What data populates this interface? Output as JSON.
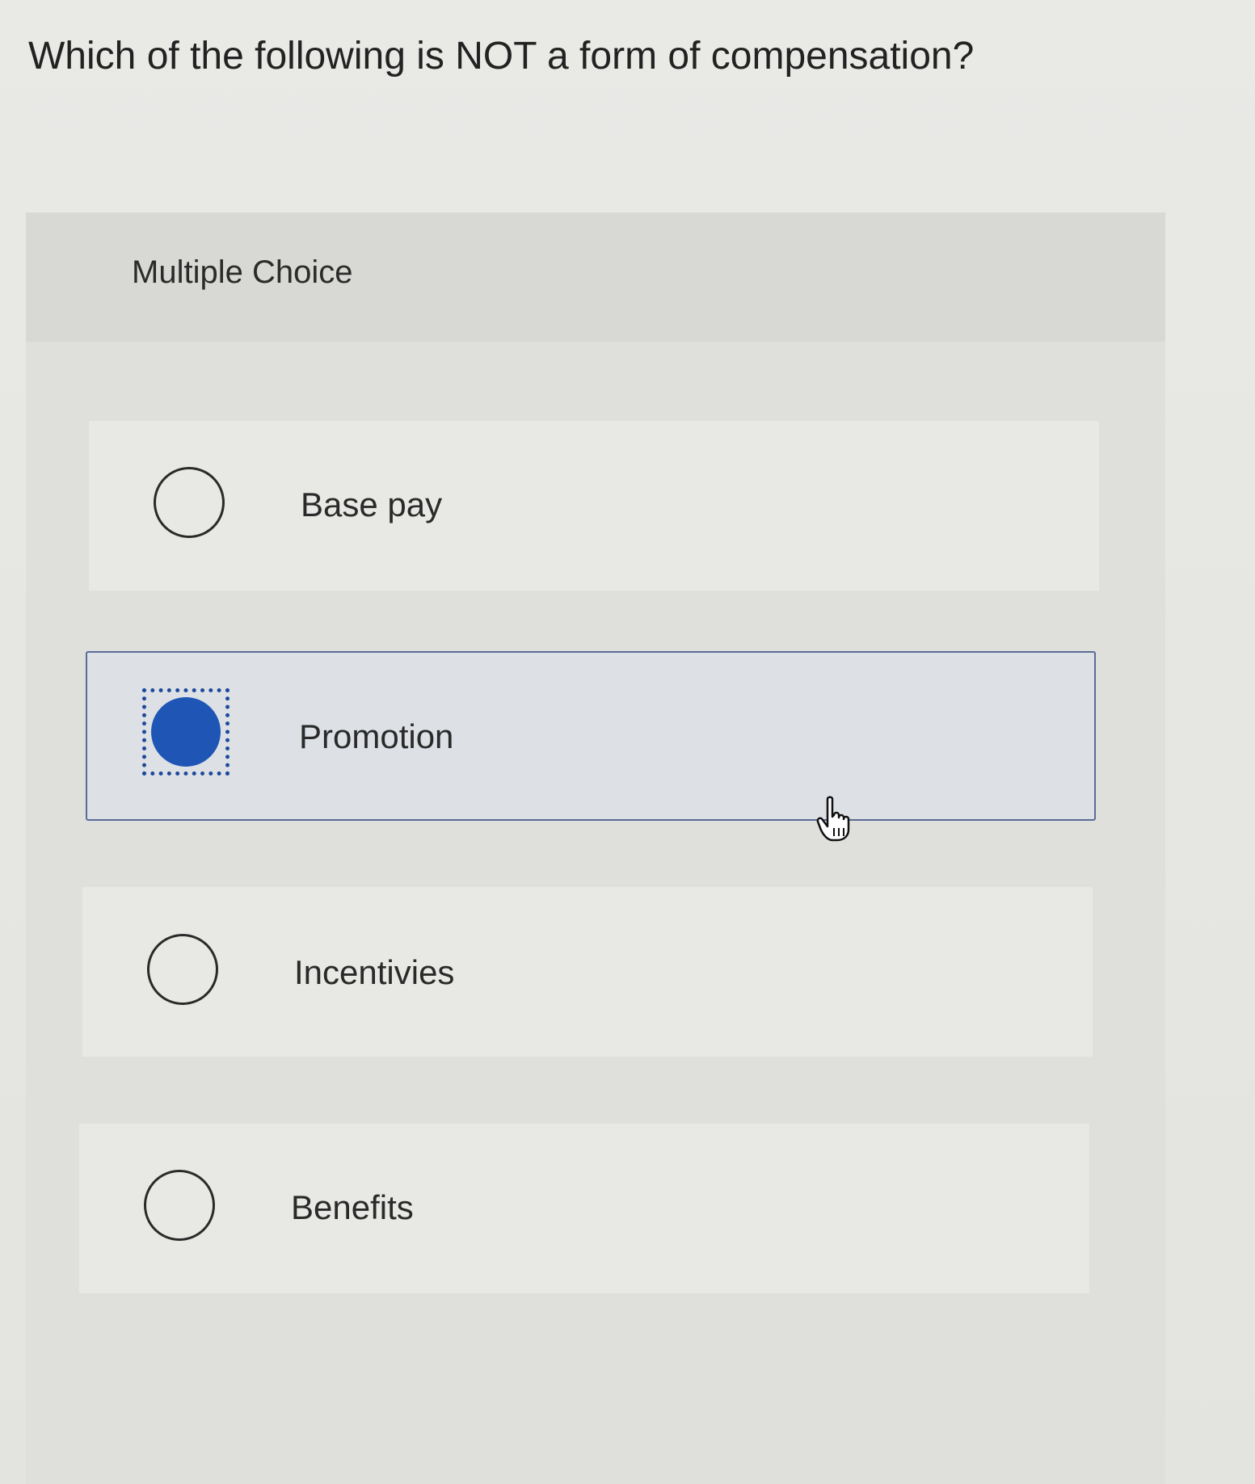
{
  "question": {
    "text": "Which of the following is NOT a form of compensation?"
  },
  "panel": {
    "type_label": "Multiple Choice"
  },
  "options": [
    {
      "label": "Base pay",
      "selected": false
    },
    {
      "label": "Promotion",
      "selected": true
    },
    {
      "label": "Incentivies",
      "selected": false
    },
    {
      "label": "Benefits",
      "selected": false
    }
  ],
  "colors": {
    "selected_fill": "#1f56b5",
    "selected_border": "#5a6d95",
    "focus_ring": "#1f4a9a"
  },
  "icons": {
    "cursor": "hand-pointer-icon"
  }
}
